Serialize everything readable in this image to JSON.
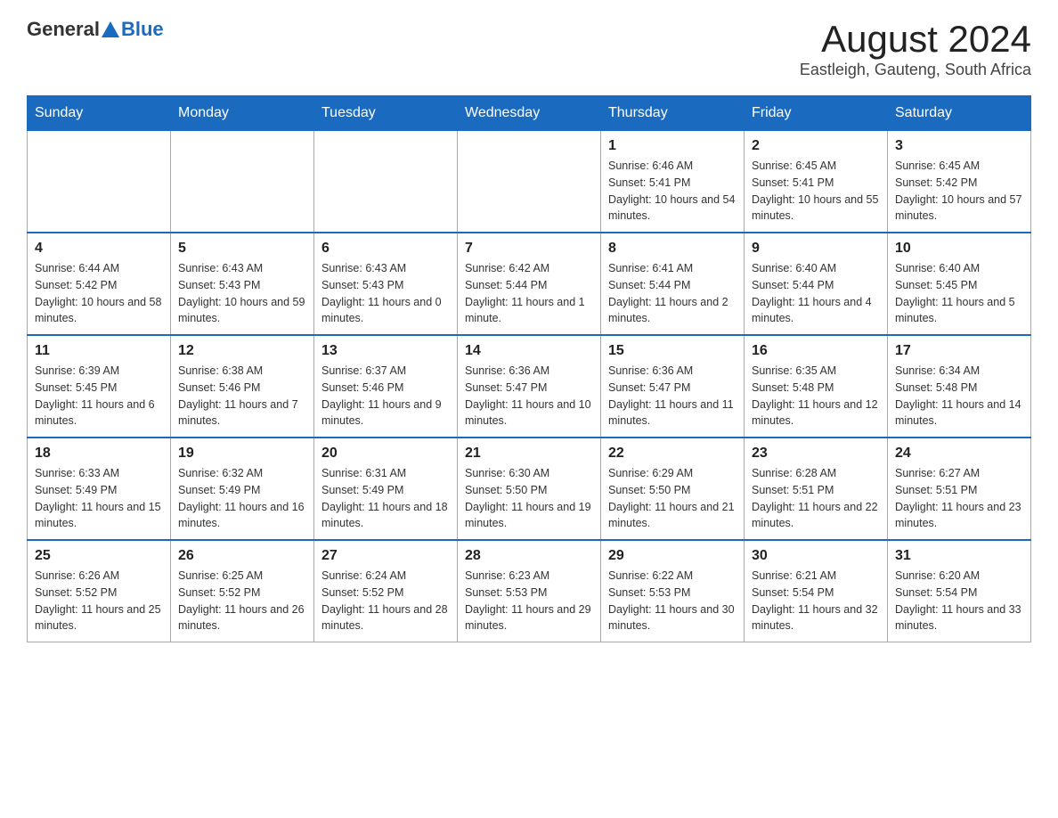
{
  "header": {
    "logo_general": "General",
    "logo_blue": "Blue",
    "title": "August 2024",
    "subtitle": "Eastleigh, Gauteng, South Africa"
  },
  "days_of_week": [
    "Sunday",
    "Monday",
    "Tuesday",
    "Wednesday",
    "Thursday",
    "Friday",
    "Saturday"
  ],
  "weeks": [
    [
      {
        "day": "",
        "info": ""
      },
      {
        "day": "",
        "info": ""
      },
      {
        "day": "",
        "info": ""
      },
      {
        "day": "",
        "info": ""
      },
      {
        "day": "1",
        "info": "Sunrise: 6:46 AM\nSunset: 5:41 PM\nDaylight: 10 hours and 54 minutes."
      },
      {
        "day": "2",
        "info": "Sunrise: 6:45 AM\nSunset: 5:41 PM\nDaylight: 10 hours and 55 minutes."
      },
      {
        "day": "3",
        "info": "Sunrise: 6:45 AM\nSunset: 5:42 PM\nDaylight: 10 hours and 57 minutes."
      }
    ],
    [
      {
        "day": "4",
        "info": "Sunrise: 6:44 AM\nSunset: 5:42 PM\nDaylight: 10 hours and 58 minutes."
      },
      {
        "day": "5",
        "info": "Sunrise: 6:43 AM\nSunset: 5:43 PM\nDaylight: 10 hours and 59 minutes."
      },
      {
        "day": "6",
        "info": "Sunrise: 6:43 AM\nSunset: 5:43 PM\nDaylight: 11 hours and 0 minutes."
      },
      {
        "day": "7",
        "info": "Sunrise: 6:42 AM\nSunset: 5:44 PM\nDaylight: 11 hours and 1 minute."
      },
      {
        "day": "8",
        "info": "Sunrise: 6:41 AM\nSunset: 5:44 PM\nDaylight: 11 hours and 2 minutes."
      },
      {
        "day": "9",
        "info": "Sunrise: 6:40 AM\nSunset: 5:44 PM\nDaylight: 11 hours and 4 minutes."
      },
      {
        "day": "10",
        "info": "Sunrise: 6:40 AM\nSunset: 5:45 PM\nDaylight: 11 hours and 5 minutes."
      }
    ],
    [
      {
        "day": "11",
        "info": "Sunrise: 6:39 AM\nSunset: 5:45 PM\nDaylight: 11 hours and 6 minutes."
      },
      {
        "day": "12",
        "info": "Sunrise: 6:38 AM\nSunset: 5:46 PM\nDaylight: 11 hours and 7 minutes."
      },
      {
        "day": "13",
        "info": "Sunrise: 6:37 AM\nSunset: 5:46 PM\nDaylight: 11 hours and 9 minutes."
      },
      {
        "day": "14",
        "info": "Sunrise: 6:36 AM\nSunset: 5:47 PM\nDaylight: 11 hours and 10 minutes."
      },
      {
        "day": "15",
        "info": "Sunrise: 6:36 AM\nSunset: 5:47 PM\nDaylight: 11 hours and 11 minutes."
      },
      {
        "day": "16",
        "info": "Sunrise: 6:35 AM\nSunset: 5:48 PM\nDaylight: 11 hours and 12 minutes."
      },
      {
        "day": "17",
        "info": "Sunrise: 6:34 AM\nSunset: 5:48 PM\nDaylight: 11 hours and 14 minutes."
      }
    ],
    [
      {
        "day": "18",
        "info": "Sunrise: 6:33 AM\nSunset: 5:49 PM\nDaylight: 11 hours and 15 minutes."
      },
      {
        "day": "19",
        "info": "Sunrise: 6:32 AM\nSunset: 5:49 PM\nDaylight: 11 hours and 16 minutes."
      },
      {
        "day": "20",
        "info": "Sunrise: 6:31 AM\nSunset: 5:49 PM\nDaylight: 11 hours and 18 minutes."
      },
      {
        "day": "21",
        "info": "Sunrise: 6:30 AM\nSunset: 5:50 PM\nDaylight: 11 hours and 19 minutes."
      },
      {
        "day": "22",
        "info": "Sunrise: 6:29 AM\nSunset: 5:50 PM\nDaylight: 11 hours and 21 minutes."
      },
      {
        "day": "23",
        "info": "Sunrise: 6:28 AM\nSunset: 5:51 PM\nDaylight: 11 hours and 22 minutes."
      },
      {
        "day": "24",
        "info": "Sunrise: 6:27 AM\nSunset: 5:51 PM\nDaylight: 11 hours and 23 minutes."
      }
    ],
    [
      {
        "day": "25",
        "info": "Sunrise: 6:26 AM\nSunset: 5:52 PM\nDaylight: 11 hours and 25 minutes."
      },
      {
        "day": "26",
        "info": "Sunrise: 6:25 AM\nSunset: 5:52 PM\nDaylight: 11 hours and 26 minutes."
      },
      {
        "day": "27",
        "info": "Sunrise: 6:24 AM\nSunset: 5:52 PM\nDaylight: 11 hours and 28 minutes."
      },
      {
        "day": "28",
        "info": "Sunrise: 6:23 AM\nSunset: 5:53 PM\nDaylight: 11 hours and 29 minutes."
      },
      {
        "day": "29",
        "info": "Sunrise: 6:22 AM\nSunset: 5:53 PM\nDaylight: 11 hours and 30 minutes."
      },
      {
        "day": "30",
        "info": "Sunrise: 6:21 AM\nSunset: 5:54 PM\nDaylight: 11 hours and 32 minutes."
      },
      {
        "day": "31",
        "info": "Sunrise: 6:20 AM\nSunset: 5:54 PM\nDaylight: 11 hours and 33 minutes."
      }
    ]
  ]
}
